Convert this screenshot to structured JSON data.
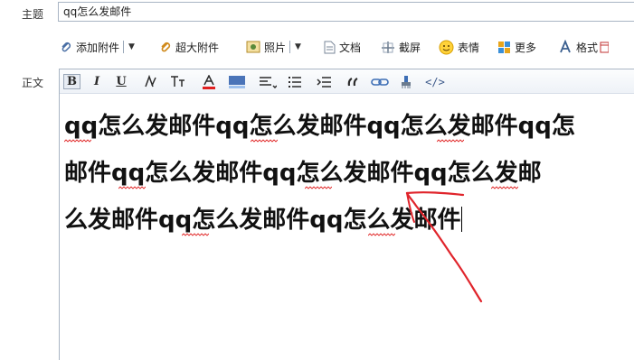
{
  "subject": {
    "label": "主题",
    "value": "qq怎么发邮件"
  },
  "attach_toolbar": {
    "add_attachment": "添加附件",
    "large_attachment": "超大附件",
    "photo": "照片",
    "document": "文档",
    "screenshot": "截屏",
    "emoji": "表情",
    "more": "更多",
    "format": "格式"
  },
  "body": {
    "label": "正文",
    "lines": [
      "qq怎么发邮件qq怎么发邮件qq怎么发邮件qq怎",
      "邮件qq怎么发邮件qq怎么发邮件qq怎么发邮",
      "么发邮件qq怎么发邮件qq怎么发邮件"
    ]
  },
  "format_toolbar": {
    "bold": "B",
    "italic": "I",
    "underline": "U",
    "html_code": "</>"
  },
  "colors": {
    "annotation_arrow": "#e0242b",
    "border": "#a9b5c4",
    "link_icon": "#3d6eb5"
  }
}
